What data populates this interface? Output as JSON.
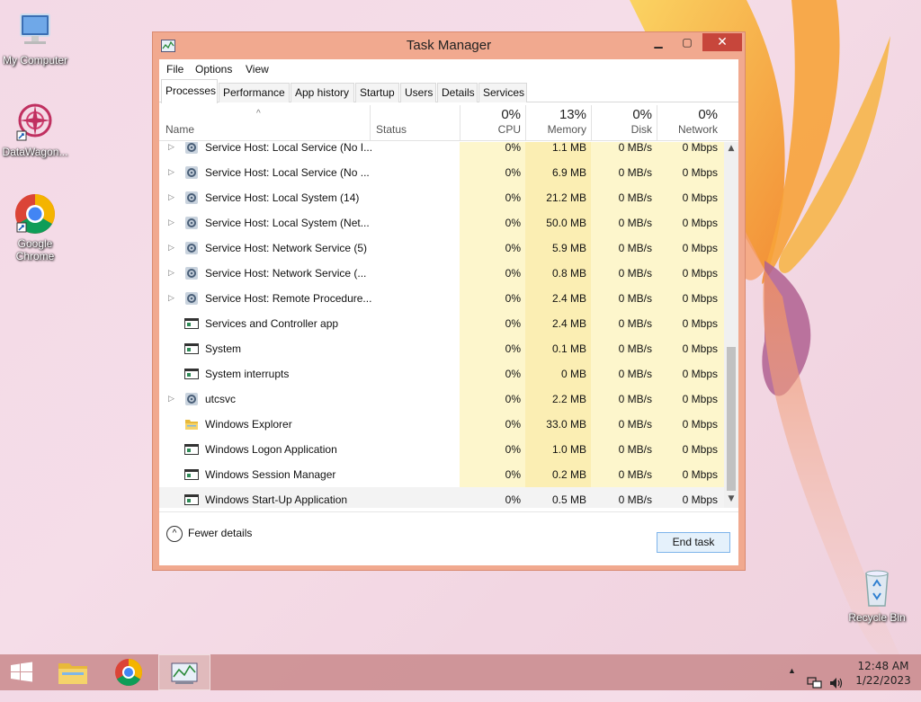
{
  "desktop": {
    "icons": [
      {
        "label": "My Computer",
        "icon": "my-computer-icon"
      },
      {
        "label": "DataWagon...",
        "icon": "datawagon-icon"
      },
      {
        "label": "Google Chrome",
        "icon": "chrome-icon"
      },
      {
        "label": "Recycle Bin",
        "icon": "recycle-bin-icon"
      }
    ]
  },
  "window": {
    "title": "Task Manager",
    "menu": [
      "File",
      "Options",
      "View"
    ],
    "tabs": [
      "Processes",
      "Performance",
      "App history",
      "Startup",
      "Users",
      "Details",
      "Services"
    ],
    "active_tab": "Processes",
    "columns": {
      "name": "Name",
      "status": "Status",
      "cpu": {
        "pct": "0%",
        "label": "CPU"
      },
      "memory": {
        "pct": "13%",
        "label": "Memory"
      },
      "disk": {
        "pct": "0%",
        "label": "Disk"
      },
      "network": {
        "pct": "0%",
        "label": "Network"
      }
    },
    "rows": [
      {
        "name": "Service Host: Local Service (No I...",
        "cpu": "0%",
        "mem": "1.1 MB",
        "disk": "0 MB/s",
        "net": "0 Mbps",
        "expand": true,
        "icon": "gear-icon"
      },
      {
        "name": "Service Host: Local Service (No ...",
        "cpu": "0%",
        "mem": "6.9 MB",
        "disk": "0 MB/s",
        "net": "0 Mbps",
        "expand": true,
        "icon": "gear-icon"
      },
      {
        "name": "Service Host: Local System (14)",
        "cpu": "0%",
        "mem": "21.2 MB",
        "disk": "0 MB/s",
        "net": "0 Mbps",
        "expand": true,
        "icon": "gear-icon"
      },
      {
        "name": "Service Host: Local System (Net...",
        "cpu": "0%",
        "mem": "50.0 MB",
        "disk": "0 MB/s",
        "net": "0 Mbps",
        "expand": true,
        "icon": "gear-icon"
      },
      {
        "name": "Service Host: Network Service (5)",
        "cpu": "0%",
        "mem": "5.9 MB",
        "disk": "0 MB/s",
        "net": "0 Mbps",
        "expand": true,
        "icon": "gear-icon"
      },
      {
        "name": "Service Host: Network Service (...",
        "cpu": "0%",
        "mem": "0.8 MB",
        "disk": "0 MB/s",
        "net": "0 Mbps",
        "expand": true,
        "icon": "gear-icon"
      },
      {
        "name": "Service Host: Remote Procedure...",
        "cpu": "0%",
        "mem": "2.4 MB",
        "disk": "0 MB/s",
        "net": "0 Mbps",
        "expand": true,
        "icon": "gear-icon"
      },
      {
        "name": "Services and Controller app",
        "cpu": "0%",
        "mem": "2.4 MB",
        "disk": "0 MB/s",
        "net": "0 Mbps",
        "expand": false,
        "icon": "app-window-icon"
      },
      {
        "name": "System",
        "cpu": "0%",
        "mem": "0.1 MB",
        "disk": "0 MB/s",
        "net": "0 Mbps",
        "expand": false,
        "icon": "app-window-icon"
      },
      {
        "name": "System interrupts",
        "cpu": "0%",
        "mem": "0 MB",
        "disk": "0 MB/s",
        "net": "0 Mbps",
        "expand": false,
        "icon": "app-window-icon"
      },
      {
        "name": "utcsvc",
        "cpu": "0%",
        "mem": "2.2 MB",
        "disk": "0 MB/s",
        "net": "0 Mbps",
        "expand": true,
        "icon": "gear-icon"
      },
      {
        "name": "Windows Explorer",
        "cpu": "0%",
        "mem": "33.0 MB",
        "disk": "0 MB/s",
        "net": "0 Mbps",
        "expand": false,
        "icon": "folder-icon"
      },
      {
        "name": "Windows Logon Application",
        "cpu": "0%",
        "mem": "1.0 MB",
        "disk": "0 MB/s",
        "net": "0 Mbps",
        "expand": false,
        "icon": "app-window-icon"
      },
      {
        "name": "Windows Session Manager",
        "cpu": "0%",
        "mem": "0.2 MB",
        "disk": "0 MB/s",
        "net": "0 Mbps",
        "expand": false,
        "icon": "app-window-icon"
      },
      {
        "name": "Windows Start-Up Application",
        "cpu": "0%",
        "mem": "0.5 MB",
        "disk": "0 MB/s",
        "net": "0 Mbps",
        "expand": false,
        "icon": "app-window-icon",
        "selected": true
      }
    ],
    "fewer_details": "Fewer details",
    "end_task": "End task"
  },
  "taskbar": {
    "items": [
      "start-icon",
      "file-explorer-icon",
      "chrome-icon",
      "task-manager-icon"
    ],
    "active_item": "task-manager-icon",
    "time": "12:48 AM",
    "date": "1/22/2023"
  },
  "colors": {
    "window_border": "#f1a98f",
    "close_button": "#c7463b",
    "cpu_col_bg": "#fdf6cc",
    "mem_col_bg": "#fbeeb3",
    "taskbar": "#c9898c"
  }
}
